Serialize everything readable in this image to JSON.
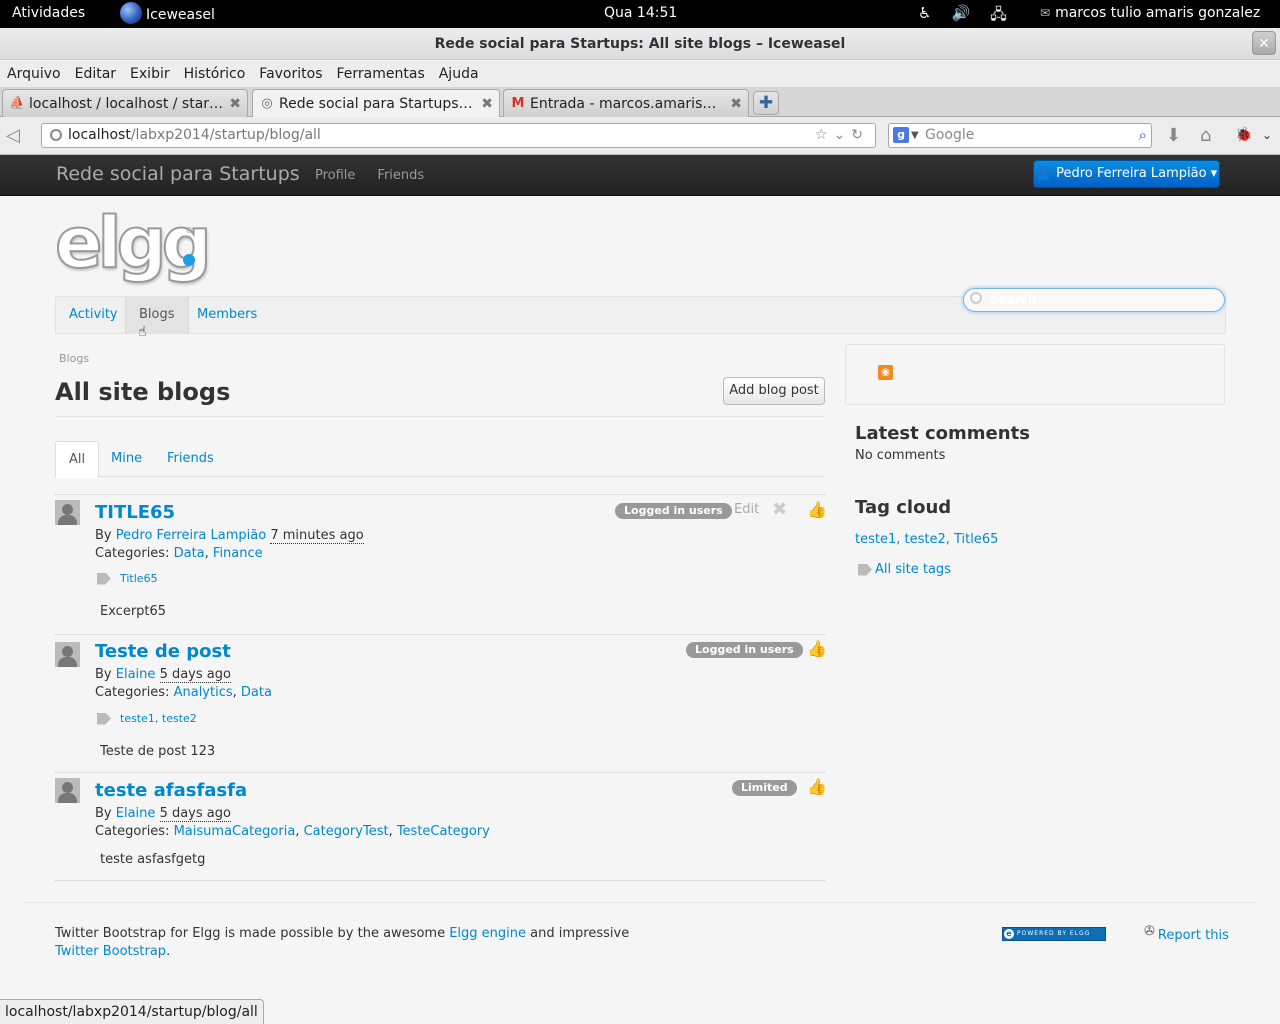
{
  "gnome": {
    "activities": "Atividades",
    "app_name": "Iceweasel",
    "clock": "Qua 14:51",
    "user": "marcos tulio amaris gonzalez"
  },
  "window": {
    "title": "Rede social para Startups: All site blogs – Iceweasel"
  },
  "menu": [
    "Arquivo",
    "Editar",
    "Exibir",
    "Histórico",
    "Favoritos",
    "Ferramentas",
    "Ajuda"
  ],
  "tabs": [
    {
      "title": "localhost / localhost / startu..."
    },
    {
      "title": "Rede social para Startups: A..."
    },
    {
      "title": "Entrada - marcos.amaris@gm..."
    }
  ],
  "nav": {
    "url_host": "localhost",
    "url_path": "/labxp2014/startup/blog/all",
    "search_placeholder": "Google"
  },
  "site": {
    "brand": "Rede social para Startups",
    "topnav": [
      "Profile",
      "Friends"
    ],
    "user_button": "Pedro Ferreira Lampião",
    "logo_text": "elgg",
    "mainnav": [
      "Activity",
      "Blogs",
      "Members"
    ],
    "search_placeholder": "Search"
  },
  "content": {
    "breadcrumb": "Blogs",
    "title": "All site blogs",
    "add_button": "Add blog post",
    "filter_tabs": [
      "All",
      "Mine",
      "Friends"
    ]
  },
  "posts": [
    {
      "title": "TITLE65",
      "by": "By",
      "author": "Pedro Ferreira Lampião",
      "time": "7 minutes ago",
      "categories_label": "Categories:",
      "categories": [
        "Data",
        "Finance"
      ],
      "tags": [
        "Title65"
      ],
      "excerpt": "Excerpt65",
      "access": "Logged in users",
      "edit": "Edit"
    },
    {
      "title": "Teste de post",
      "by": "By",
      "author": "Elaine",
      "time": "5 days ago",
      "categories_label": "Categories:",
      "categories": [
        "Analytics",
        "Data"
      ],
      "tags": [
        "teste1",
        "teste2"
      ],
      "excerpt": "Teste de post 123",
      "access": "Logged in users"
    },
    {
      "title": "teste afasfasfa",
      "by": "By",
      "author": "Elaine",
      "time": "5 days ago",
      "categories_label": "Categories:",
      "categories": [
        "MaisumaCategoria",
        "CategoryTest",
        "TesteCategory"
      ],
      "excerpt": "teste asfasfgetg",
      "access": "Limited"
    }
  ],
  "sidebar": {
    "latest_comments_title": "Latest comments",
    "no_comments": "No comments",
    "tag_cloud_title": "Tag cloud",
    "tags": [
      "teste1",
      "teste2",
      "Title65"
    ],
    "all_site_tags": "All site tags"
  },
  "footer": {
    "text_1": "Twitter Bootstrap for Elgg is made possible by the awesome",
    "link_1": "Elgg engine",
    "text_2": "and impressive",
    "link_2": "Twitter Bootstrap",
    "text_3": ".",
    "powered": "POWERED BY ELGG",
    "report": "Report this"
  },
  "status_url": "localhost/labxp2014/startup/blog/all"
}
